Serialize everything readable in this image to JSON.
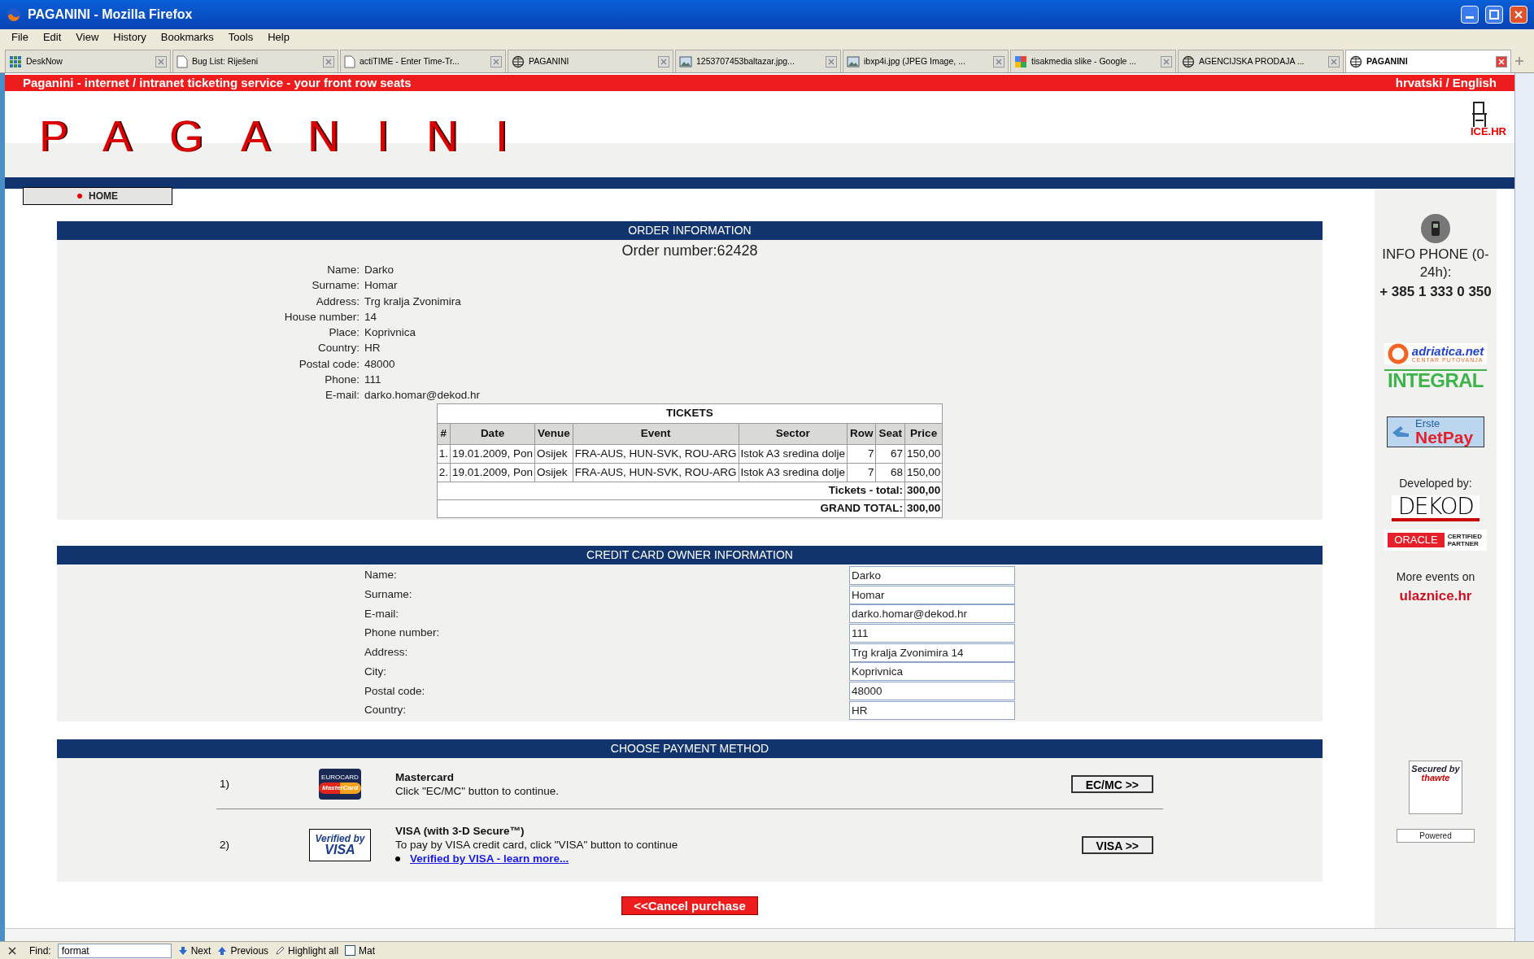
{
  "window": {
    "title": "PAGANINI - Mozilla Firefox"
  },
  "menu": [
    "File",
    "Edit",
    "View",
    "History",
    "Bookmarks",
    "Tools",
    "Help"
  ],
  "tabs": [
    {
      "label": "DeskNow",
      "kind": "grid",
      "selected": false
    },
    {
      "label": "Bug List: Riješeni",
      "kind": "page",
      "selected": false
    },
    {
      "label": "actiTIME - Enter Time-Tr...",
      "kind": "page",
      "selected": false
    },
    {
      "label": "PAGANINI",
      "kind": "globe",
      "selected": false
    },
    {
      "label": "1253707453baltazar.jpg...",
      "kind": "image",
      "selected": false
    },
    {
      "label": "ibxp4i.jpg (JPEG Image, ...",
      "kind": "image",
      "selected": false
    },
    {
      "label": "tisakmedia slike - Google ...",
      "kind": "google",
      "selected": false
    },
    {
      "label": "AGENCIJSKA PRODAJA ...",
      "kind": "globe",
      "selected": false
    },
    {
      "label": "PAGANINI",
      "kind": "globe",
      "selected": true
    }
  ],
  "site": {
    "tagline": "Paganini - internet / intranet ticketing service - your front row seats",
    "language": "hrvatski / English",
    "logo": "PAGANINI",
    "partner_logo": "ICE.HR"
  },
  "nav": [
    {
      "label": "HOME"
    }
  ],
  "order_info": {
    "heading": "ORDER INFORMATION",
    "order_number": "Order number:62428",
    "fields": [
      {
        "label": "Name:",
        "value": "Darko"
      },
      {
        "label": "Surname:",
        "value": "Homar"
      },
      {
        "label": "Address:",
        "value": "Trg kralja Zvonimira"
      },
      {
        "label": "House number:",
        "value": "14"
      },
      {
        "label": "Place:",
        "value": "Koprivnica"
      },
      {
        "label": "Country:",
        "value": "HR"
      },
      {
        "label": "Postal code:",
        "value": "48000"
      },
      {
        "label": "Phone:",
        "value": "111"
      },
      {
        "label": "E-mail:",
        "value": "darko.homar@dekod.hr"
      }
    ]
  },
  "tickets": {
    "title": "TICKETS",
    "columns": [
      "#",
      "Date",
      "Venue",
      "Event",
      "Sector",
      "Row",
      "Seat",
      "Price"
    ],
    "rows": [
      [
        "1.",
        "19.01.2009, Pon",
        "Osijek",
        "FRA-AUS, HUN-SVK, ROU-ARG",
        "Istok A3 sredina dolje",
        "7",
        "67",
        "150,00"
      ],
      [
        "2.",
        "19.01.2009, Pon",
        "Osijek",
        "FRA-AUS, HUN-SVK, ROU-ARG",
        "Istok A3 sredina dolje",
        "7",
        "68",
        "150,00"
      ]
    ],
    "totals": [
      {
        "label": "Tickets - total:",
        "value": "300,00"
      },
      {
        "label": "GRAND TOTAL:",
        "value": "300,00"
      }
    ]
  },
  "credit_card": {
    "heading": "CREDIT CARD OWNER INFORMATION",
    "fields": [
      {
        "label": "Name:",
        "value": "Darko"
      },
      {
        "label": "Surname:",
        "value": "Homar"
      },
      {
        "label": "E-mail:",
        "value": "darko.homar@dekod.hr"
      },
      {
        "label": "Phone number:",
        "value": "111"
      },
      {
        "label": "Address:",
        "value": "Trg kralja Zvonimira 14"
      },
      {
        "label": "City:",
        "value": "Koprivnica"
      },
      {
        "label": "Postal code:",
        "value": "48000"
      },
      {
        "label": "Country:",
        "value": "HR"
      }
    ]
  },
  "payment": {
    "heading": "CHOOSE PAYMENT METHOD",
    "methods": [
      {
        "number": "1)",
        "kind": "mastercard",
        "logo_top": "EUROCARD",
        "logo_main": "MasterCard",
        "title": "Mastercard",
        "description": "Click \"EC/MC\" button to continue.",
        "button": "EC/MC >>"
      },
      {
        "number": "2)",
        "kind": "visa",
        "logo_top": "Verified by",
        "logo_main": "VISA",
        "title": "VISA (with 3-D Secure™)",
        "description": "To pay by VISA credit card, click \"VISA\" button to continue",
        "link": "Verified by VISA - learn more...",
        "button": "VISA >>"
      }
    ]
  },
  "cancel_button": "<<Cancel purchase",
  "sidebar": {
    "phone_title": "INFO PHONE (0-24h):",
    "phone": "+ 385 1 333 0 350",
    "logos": [
      {
        "kind": "adriatica",
        "text": "adriatica.net",
        "sub": "CENTAR PUTOVANJA"
      },
      {
        "kind": "integral",
        "text": "INTEGRAL"
      },
      {
        "kind": "netpay",
        "text": "Erste",
        "sub": "NetPay"
      }
    ],
    "developed_by": "Developed by:",
    "dev_logos": [
      {
        "kind": "dekod",
        "text": "DEKOD"
      },
      {
        "kind": "oracle",
        "text": "ORACLE",
        "sub": "CERTIFIED PARTNER"
      }
    ],
    "more_events": "More events on",
    "more_link": "ulaznice.hr",
    "secured": "Secured by",
    "thawte": "thawte",
    "powered": "Powered"
  },
  "find_bar": {
    "label": "Find:",
    "value": "format",
    "next": "Next",
    "previous": "Previous",
    "highlight": "Highlight all",
    "match": "Mat",
    "match_checked": false
  }
}
